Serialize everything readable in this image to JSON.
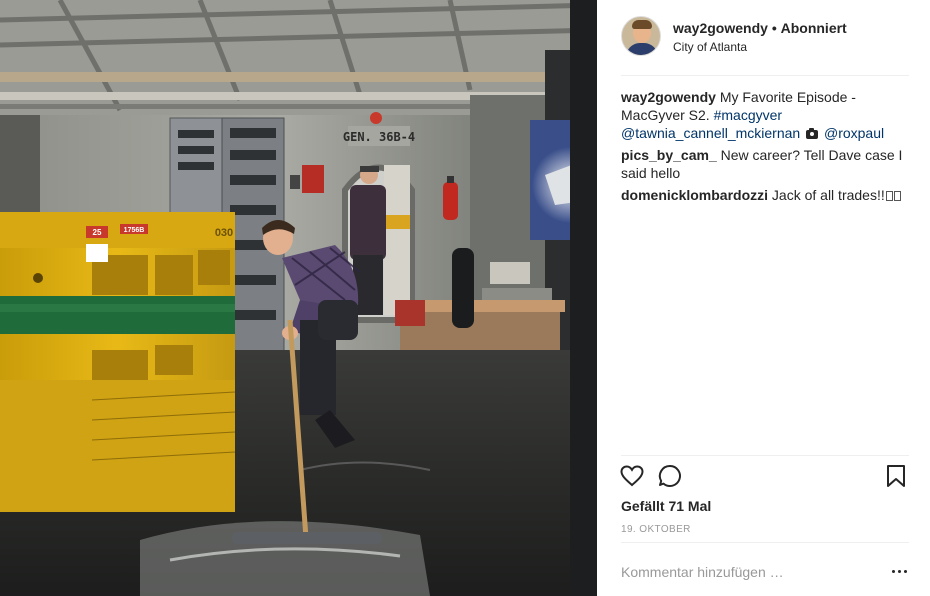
{
  "post": {
    "username": "way2gowendy",
    "separator": "•",
    "follow_label": "Abonniert",
    "location": "City of Atlanta"
  },
  "caption": {
    "username": "way2gowendy",
    "text": "My Favorite Episode - MacGyver S2.",
    "hashtag": "#macgyver",
    "mention_1": "@tawnia_cannell_mckiernan",
    "camera_icon": "camera-icon",
    "mention_2": "@roxpaul"
  },
  "comments": [
    {
      "username": "pics_by_cam_",
      "text": "New career? Tell Dave case I said hello"
    },
    {
      "username": "domenicklombardozzi",
      "text": "Jack of all trades!!"
    }
  ],
  "photo_text": {
    "sign": "GEN. 36B-4",
    "label_25": "25",
    "label_1756": "1756B",
    "label_030": "030"
  },
  "actions": {
    "like_icon": "heart-icon",
    "comment_icon": "comment-bubble-icon",
    "save_icon": "bookmark-icon"
  },
  "likes": "Gefällt 71 Mal",
  "date": "19. OKTOBER",
  "comment_box": {
    "placeholder": "Kommentar hinzufügen …",
    "more_icon": "more-options-icon"
  },
  "colors": {
    "link": "#003569",
    "text": "#262626",
    "muted": "#999999",
    "border": "#efefef",
    "generator_yellow": "#e8b916",
    "generator_green": "#1f6b3a"
  }
}
